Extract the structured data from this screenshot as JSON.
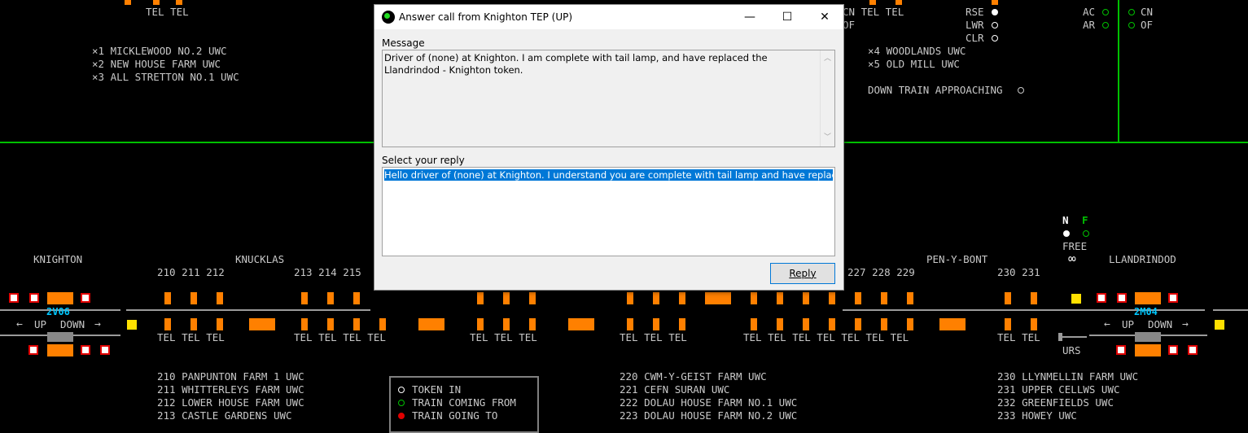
{
  "dialog": {
    "title": "Answer call from Knighton TEP (UP)",
    "message_label": "Message",
    "message_text": "Driver of (none) at Knighton. I am complete with tail lamp, and have replaced the Llandrindod - Knighton token.",
    "reply_label": "Select your reply",
    "reply_option": "Hello driver of (none) at Knighton. I understand you are complete with tail lamp and have replaced the",
    "reply_button": "Reply",
    "controls": {
      "minimize": "—",
      "maximize": "☐",
      "close": "✕"
    }
  },
  "panel": {
    "top_tel_left": "TEL TEL",
    "uwc_left": [
      "×1 MICKLEWOOD NO.2 UWC",
      "×2 NEW HOUSE FARM UWC",
      "×3 ALL STRETTON NO.1 UWC"
    ],
    "uwc_right": [
      "×4 WOODLANDS UWC",
      "×5 OLD MILL UWC"
    ],
    "down_train_approaching": "DOWN TRAIN APPROACHING",
    "top_right_tel": "CN TEL TEL",
    "of_label": "OF",
    "rse": "RSE",
    "lwr": "LWR",
    "clr": "CLR",
    "ac": "AC",
    "ar": "AR",
    "cn": "CN",
    "of2": "OF",
    "n": "N",
    "f": "F",
    "free": "FREE",
    "inf": "∞",
    "stations": {
      "knighton": "KNIGHTON",
      "knucklas": "KNUCKLAS",
      "pen_y_bont": "PEN-Y-BONT",
      "llandrindod": "LLANDRINDOD"
    },
    "crossing_numbers": {
      "g1": "210 211 212",
      "g2": "213 214 215",
      "g3": "227 228 229",
      "g4": "230 231"
    },
    "tel_groups": {
      "a": "TEL TEL TEL",
      "b": "TEL TEL TEL TEL",
      "c": "TEL TEL TEL",
      "d": "TEL TEL TEL",
      "e": "TEL TEL TEL TEL TEL TEL TEL",
      "f": "TEL TEL"
    },
    "train_descriptions": {
      "knighton": "2V06",
      "llandrindod": "2M04"
    },
    "up": "UP",
    "down": "DOWN",
    "urs": "URS",
    "uwc_bottom_1": [
      "210 PANPUNTON FARM 1 UWC",
      "211 WHITTERLEYS FARM UWC",
      "212 LOWER HOUSE FARM UWC",
      "213 CASTLE GARDENS UWC"
    ],
    "uwc_bottom_2": [
      "220 CWM-Y-GEIST FARM UWC",
      "221 CEFN SURAN UWC",
      "222 DOLAU HOUSE FARM NO.1 UWC",
      "223 DOLAU HOUSE FARM NO.2 UWC"
    ],
    "uwc_bottom_3": [
      "230 LLYNMELLIN FARM UWC",
      "231 UPPER CELLWS UWC",
      "232 GREENFIELDS UWC",
      "233 HOWEY UWC"
    ],
    "legend": [
      "TOKEN IN",
      "TRAIN COMING FROM",
      "TRAIN GOING TO"
    ]
  },
  "colors": {
    "track_occupied": "#ff8000",
    "line": "#00c000",
    "signal_red": "#e00000",
    "signal_yellow": "#ffe000",
    "desc": "#00c8ff"
  }
}
